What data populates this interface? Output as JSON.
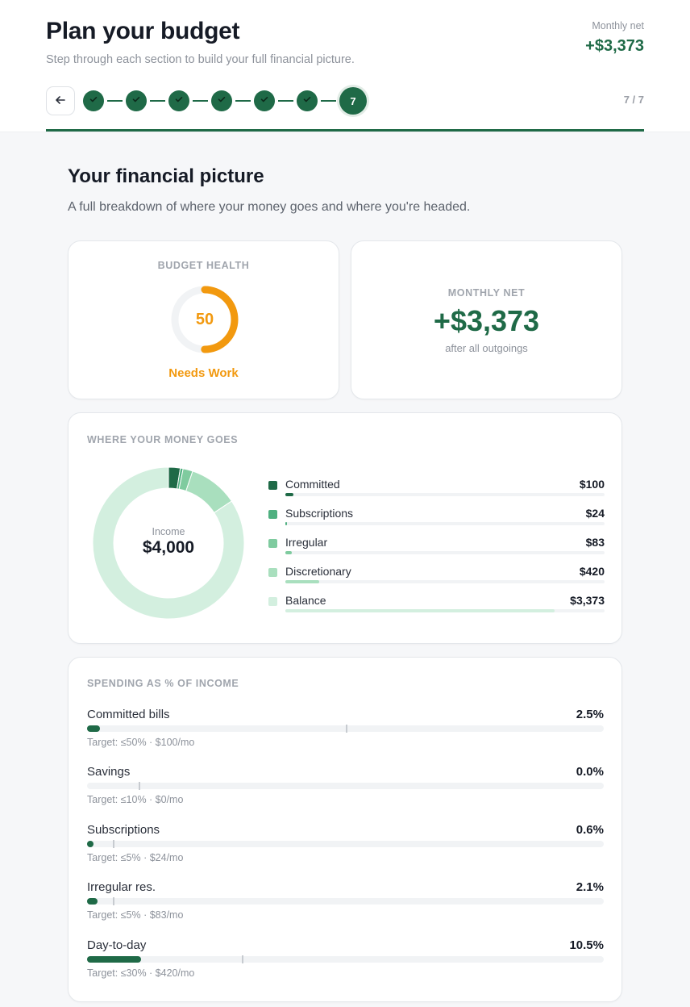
{
  "header": {
    "title": "Plan your budget",
    "subtitle": "Step through each section to build your full financial picture.",
    "net_label": "Monthly net",
    "net_value": "+$3,373",
    "current_step": "7",
    "step_count": "7 / 7",
    "completed_steps": 6,
    "progress_fraction": 1.0
  },
  "section": {
    "title": "Your financial picture",
    "subtitle": "A full breakdown of where your money goes and where you're headed."
  },
  "health": {
    "label": "BUDGET HEALTH",
    "score": "50",
    "score_value": 50,
    "status": "Needs Work",
    "color": "#f2990f"
  },
  "net": {
    "label": "MONTHLY NET",
    "value": "+$3,373",
    "caption": "after all outgoings"
  },
  "money": {
    "label": "WHERE YOUR MONEY GOES",
    "center_label": "Income",
    "center_value": "$4,000",
    "income": 4000,
    "items": [
      {
        "name": "Committed",
        "amount": "$100",
        "value": 100,
        "color": "#1f6a47"
      },
      {
        "name": "Subscriptions",
        "amount": "$24",
        "value": 24,
        "color": "#4fb080"
      },
      {
        "name": "Irregular",
        "amount": "$83",
        "value": 83,
        "color": "#7fcb9f"
      },
      {
        "name": "Discretionary",
        "amount": "$420",
        "value": 420,
        "color": "#a9dfbe"
      },
      {
        "name": "Balance",
        "amount": "$3,373",
        "value": 3373,
        "color": "#d3efdf"
      }
    ]
  },
  "spending": {
    "label": "SPENDING AS % OF INCOME",
    "rows": [
      {
        "name": "Committed bills",
        "pct": "2.5%",
        "value": 2.5,
        "target_pct": 50,
        "target": "Target: ≤50% · $100/mo"
      },
      {
        "name": "Savings",
        "pct": "0.0%",
        "value": 0.0,
        "target_pct": 10,
        "target": "Target: ≤10% · $0/mo"
      },
      {
        "name": "Subscriptions",
        "pct": "0.6%",
        "value": 0.6,
        "target_pct": 5,
        "target": "Target: ≤5% · $24/mo"
      },
      {
        "name": "Irregular res.",
        "pct": "2.1%",
        "value": 2.1,
        "target_pct": 5,
        "target": "Target: ≤5% · $83/mo"
      },
      {
        "name": "Day-to-day",
        "pct": "10.5%",
        "value": 10.5,
        "target_pct": 30,
        "target": "Target: ≤30% · $420/mo"
      }
    ]
  }
}
